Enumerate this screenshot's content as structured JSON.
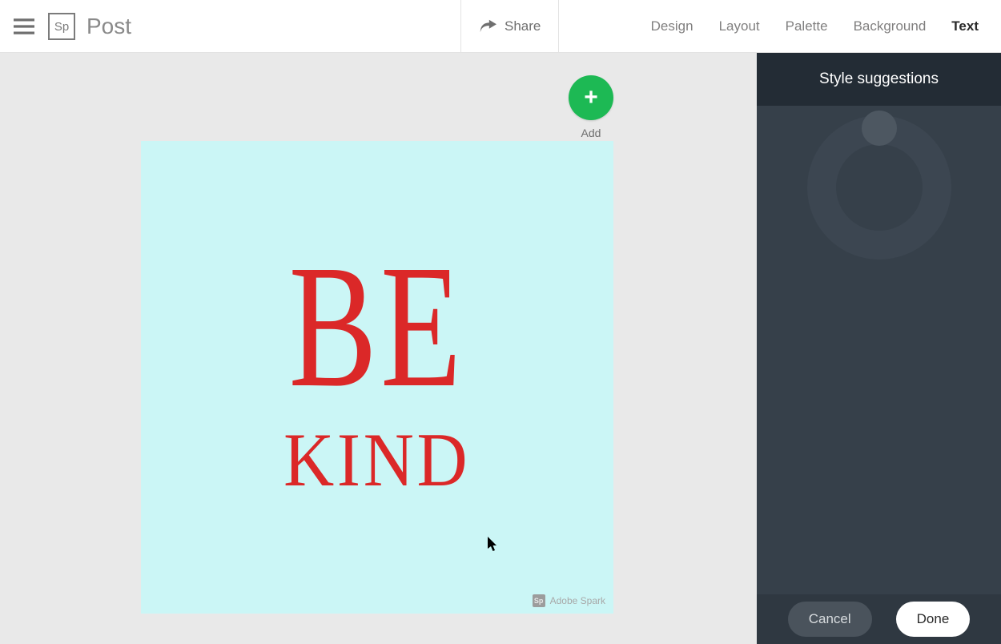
{
  "header": {
    "app_name": "Post",
    "logo_text": "Sp",
    "share_label": "Share",
    "tabs": [
      {
        "label": "Design",
        "active": false
      },
      {
        "label": "Layout",
        "active": false
      },
      {
        "label": "Palette",
        "active": false
      },
      {
        "label": "Background",
        "active": false
      },
      {
        "label": "Text",
        "active": true
      }
    ]
  },
  "canvas": {
    "add_label": "Add",
    "background_color": "#cbf6f6",
    "text_color": "#db2828",
    "line1": "BE",
    "line2": "KIND",
    "watermark": {
      "logo": "Sp",
      "text": "Adobe Spark"
    }
  },
  "sidebar": {
    "title": "Style suggestions",
    "cancel_label": "Cancel",
    "done_label": "Done"
  }
}
